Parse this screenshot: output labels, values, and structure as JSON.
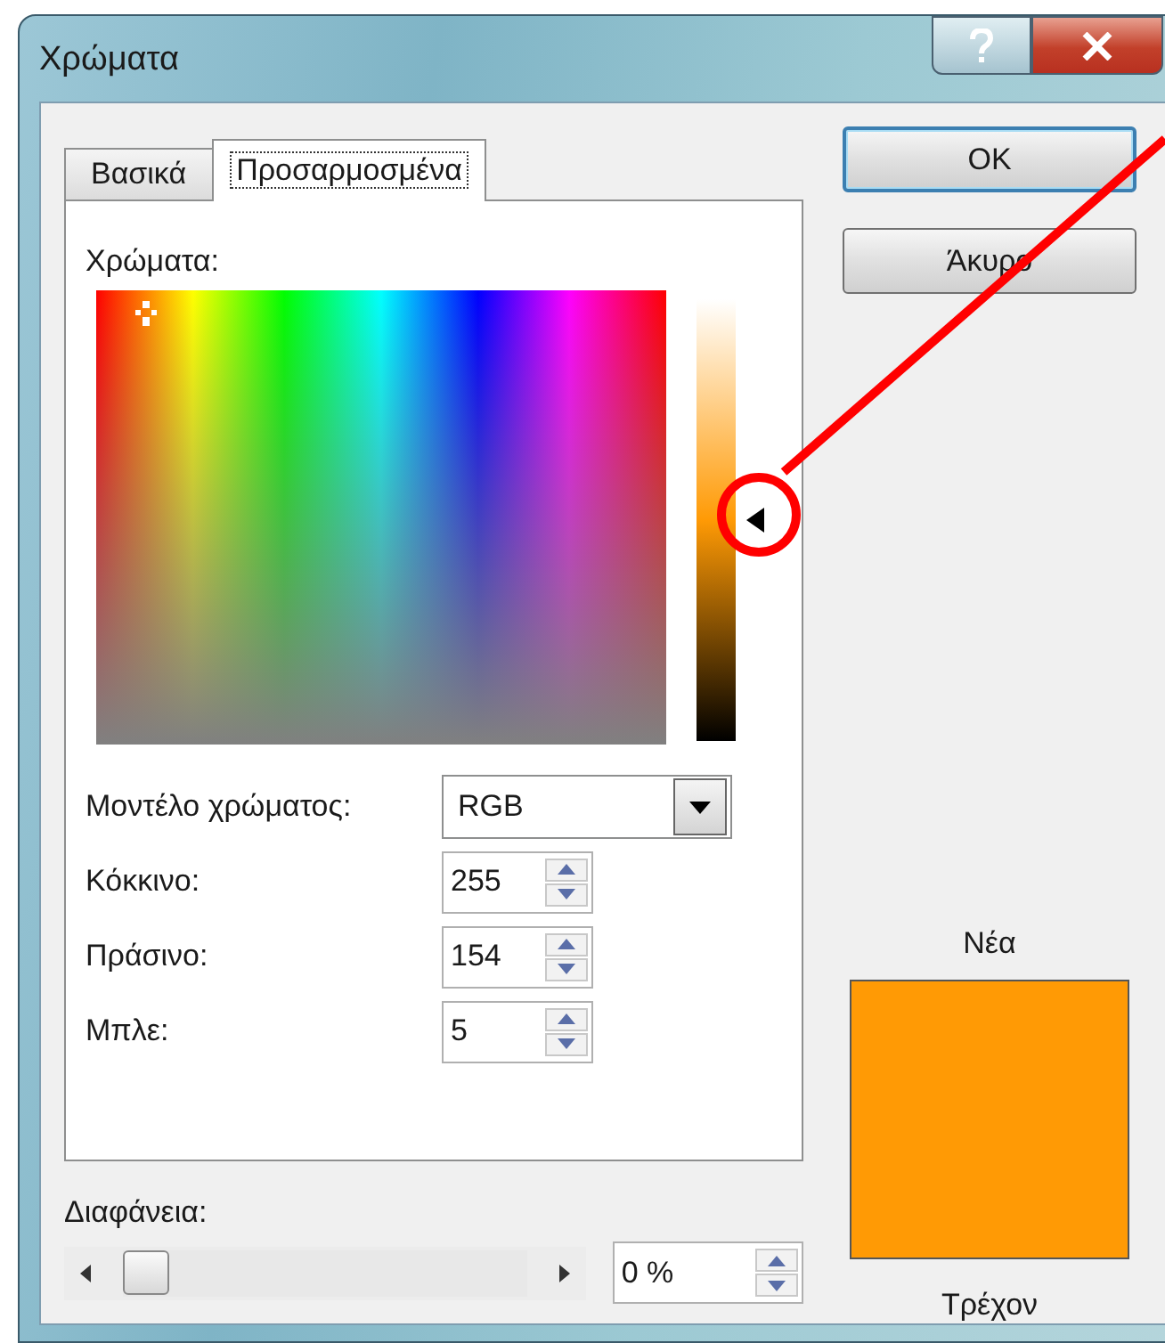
{
  "window": {
    "title": "Χρώματα"
  },
  "tabs": [
    {
      "label": "Βασικά",
      "selected": false
    },
    {
      "label": "Προσαρμοσμένα",
      "selected": true
    }
  ],
  "colors_label": "Χρώματα:",
  "luminance": {
    "level": 0.5
  },
  "color_model": {
    "label": "Μοντέλο χρώματος:",
    "value": "RGB"
  },
  "channels": [
    {
      "label": "Κόκκινο:",
      "value": "255"
    },
    {
      "label": "Πράσινο:",
      "value": "154"
    },
    {
      "label": "Μπλε:",
      "value": "5"
    }
  ],
  "transparency": {
    "label": "Διαφάνεια:",
    "level": 0,
    "value": "0 %"
  },
  "buttons": [
    {
      "label": "OK",
      "kind": "default"
    },
    {
      "label": "Άκυρο",
      "kind": "normal"
    }
  ],
  "preview": {
    "new_label": "Νέα",
    "current_label": "Τρέχον"
  }
}
